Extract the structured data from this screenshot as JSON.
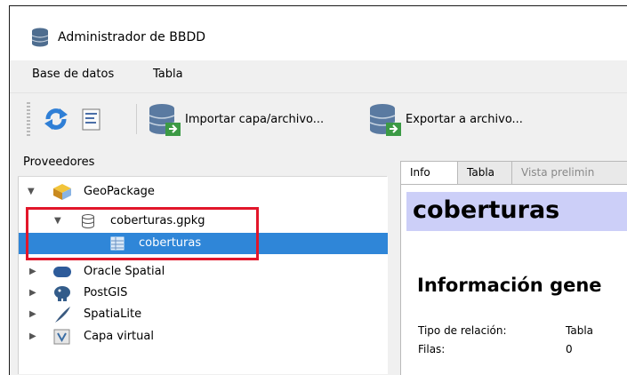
{
  "window": {
    "title": "Administrador de BBDD"
  },
  "menubar": {
    "items": [
      "Base de datos",
      "Tabla"
    ]
  },
  "toolbar": {
    "import_label": "Importar capa/archivo...",
    "export_label": "Exportar a archivo..."
  },
  "providers": {
    "header": "Proveedores",
    "items": [
      {
        "label": "GeoPackage",
        "icon": "geopackage-icon",
        "expanded": true
      },
      {
        "label": "coberturas.gpkg",
        "icon": "database-icon",
        "expanded": true
      },
      {
        "label": "coberturas",
        "icon": "table-icon",
        "selected": true
      },
      {
        "label": "Oracle Spatial",
        "icon": "oracle-icon"
      },
      {
        "label": "PostGIS",
        "icon": "postgis-icon"
      },
      {
        "label": "SpatiaLite",
        "icon": "spatialite-icon"
      },
      {
        "label": "Capa virtual",
        "icon": "virtual-layer-icon"
      }
    ]
  },
  "tabs": [
    "Info",
    "Tabla",
    "Vista prelimin"
  ],
  "info": {
    "title": "coberturas",
    "section": "Información gene",
    "rows": [
      {
        "key": "Tipo de relación:",
        "value": "Tabla"
      },
      {
        "key": "Filas:",
        "value": "0"
      }
    ]
  },
  "colors": {
    "selection": "#2f86d8",
    "highlight_box": "#e2162a",
    "heading_bg": "#cccff8"
  }
}
